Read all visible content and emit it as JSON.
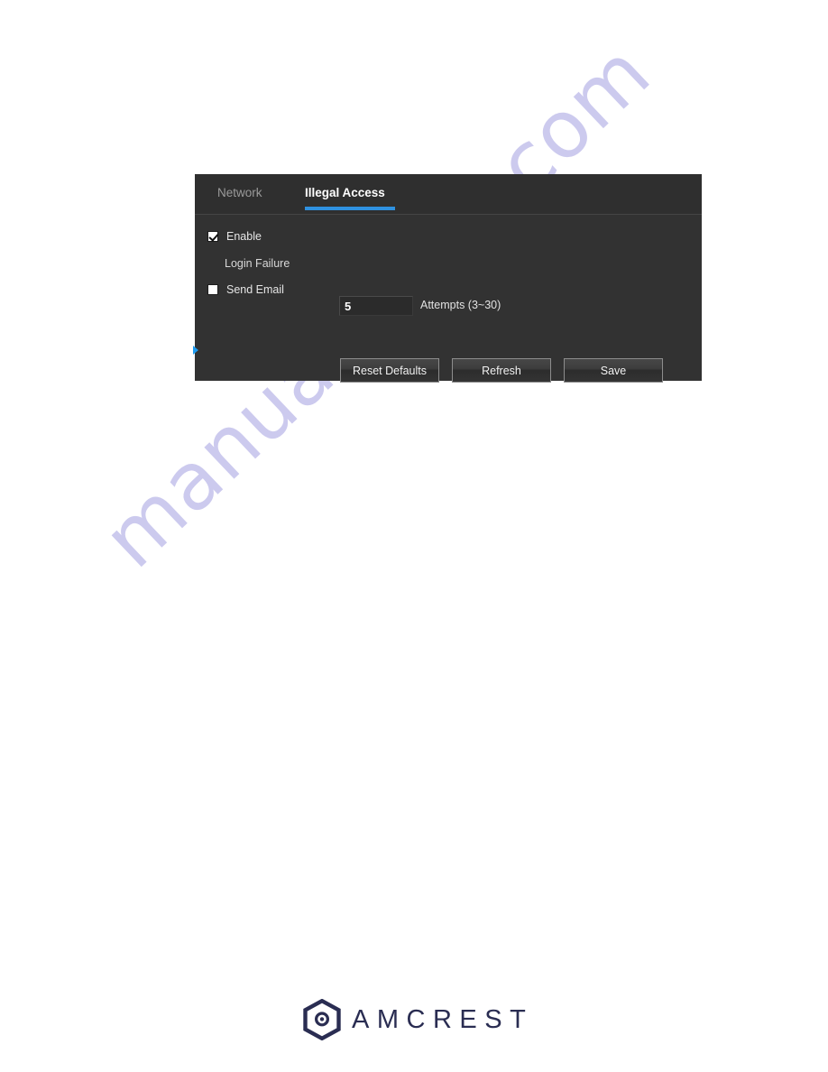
{
  "page": {
    "background_color": "#ffffff",
    "watermark": {
      "text": "manualshive.com",
      "color": "#b9b6e8"
    }
  },
  "panel": {
    "background_color": "#323232",
    "accent_color": "#2f91e0",
    "tabs": [
      {
        "label": "Network",
        "active": false
      },
      {
        "label": "Illegal Access",
        "active": true
      }
    ],
    "fields": {
      "enable": {
        "label": "Enable",
        "checked": true
      },
      "login_failure": {
        "label": "Login Failure",
        "value": "5",
        "placeholder": "5",
        "unit": "Attempts (3~30)"
      },
      "send_email": {
        "label": "Send Email",
        "checked": false
      }
    },
    "buttons": {
      "reset_defaults": "Reset Defaults",
      "refresh": "Refresh",
      "save": "Save"
    }
  },
  "footer": {
    "brand": "AMCREST",
    "brand_color": "#2a2d52"
  }
}
